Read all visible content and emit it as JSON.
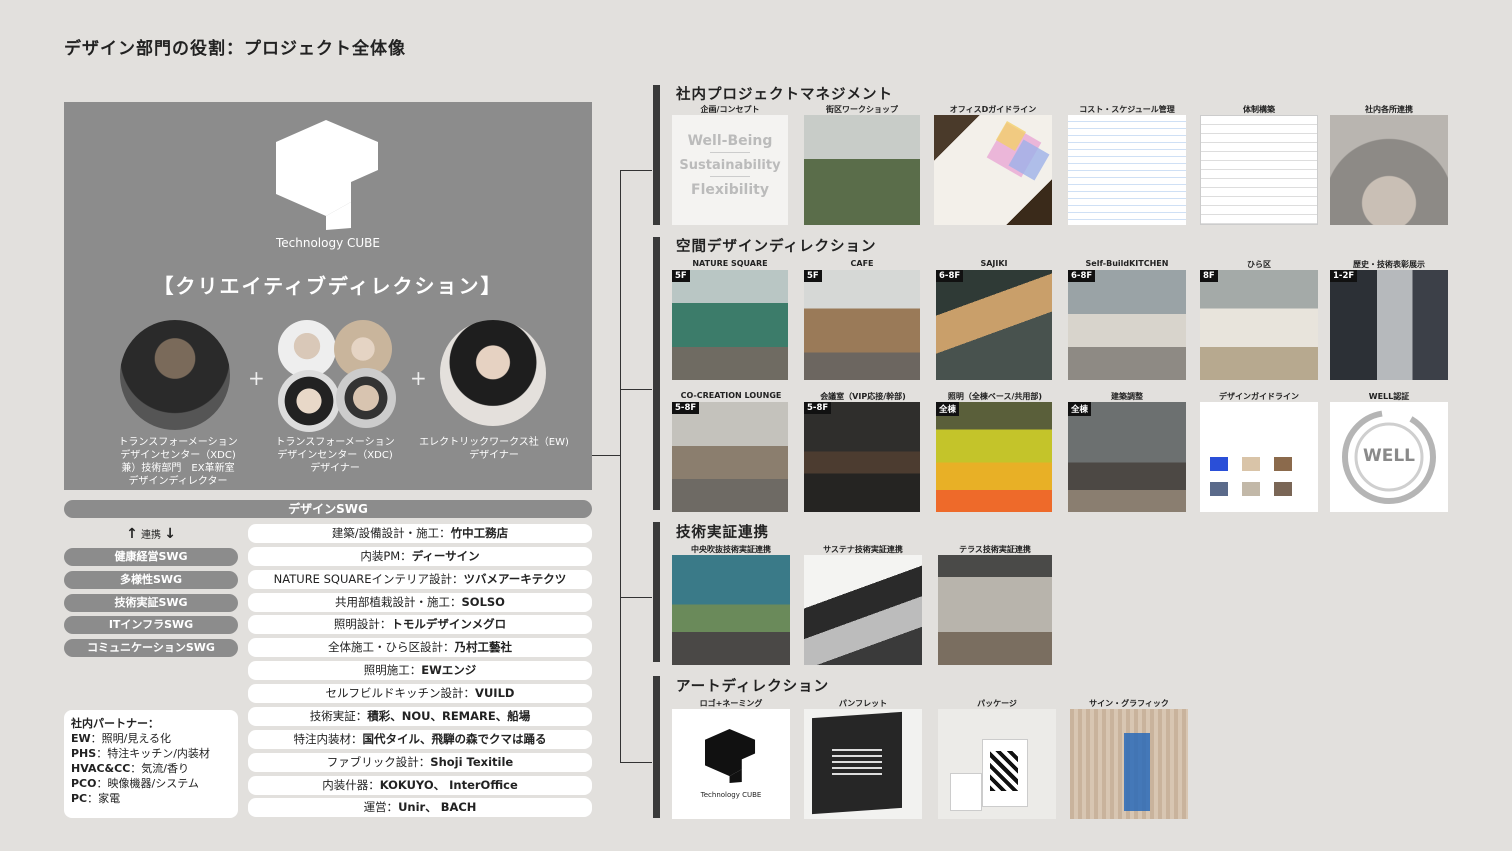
{
  "page_title": "デザイン部門の役割：プロジェクト全体像",
  "hero": {
    "logo_text": "Technology CUBE",
    "title": "【クリエイティブディレクション】",
    "plus": "+",
    "captions": [
      [
        "トランスフォーメーション",
        "デザインセンター（XDC)",
        "兼）技術部門　EX革新室",
        "デザインディレクター"
      ],
      [
        "トランスフォーメーション",
        "デザインセンター（XDC)",
        "デザイナー"
      ],
      [
        "エレクトリックワークス社（EW)",
        "デザイナー"
      ]
    ]
  },
  "swg": {
    "main": "デザインSWG",
    "renkei": "連携",
    "pills": [
      "健康経営SWG",
      "多様性SWG",
      "技術実証SWG",
      "ITインフラSWG",
      "コミュニケーションSWG"
    ]
  },
  "roles": [
    {
      "label": "建築/設備設計・施工：",
      "value": "竹中工務店"
    },
    {
      "label": "内装PM：",
      "value": "ディーサイン"
    },
    {
      "label": "NATURE SQUAREインテリア設計：",
      "value": "ツバメアーキテクツ"
    },
    {
      "label": "共用部植栽設計・施工：",
      "value": "SOLSO"
    },
    {
      "label": "照明設計：",
      "value": "トモルデザインメグロ"
    },
    {
      "label": "全体施工・ひら区設計：",
      "value": "乃村工藝社"
    },
    {
      "label": "照明施工：",
      "value": "EWエンジ"
    },
    {
      "label": "セルフビルドキッチン設計：",
      "value": "VUILD"
    },
    {
      "label": "技術実証：",
      "value": "積彩、NOU、REMARE、船場"
    },
    {
      "label": "特注内装材：",
      "value": "国代タイル、飛騨の森でクマは踊る"
    },
    {
      "label": "ファブリック設計：",
      "value": "Shoji Texitile"
    },
    {
      "label": "内装什器：",
      "value": "KOKUYO、 InterOffice"
    },
    {
      "label": "運営：",
      "value": "Unir、 BACH"
    }
  ],
  "partner": {
    "title": "社内パートナー：",
    "lines": [
      {
        "k": "EW",
        "v": "：照明/見える化"
      },
      {
        "k": "PHS",
        "v": "：特注キッチン/内装材"
      },
      {
        "k": "HVAC&CC",
        "v": "：気流/香り"
      },
      {
        "k": "PCO",
        "v": "：映像機器/システム"
      },
      {
        "k": "PC",
        "v": "：家電"
      }
    ]
  },
  "sections": {
    "pm": {
      "title": "社内プロジェクトマネジメント",
      "items": [
        "企画/コンセプト",
        "街区ワークショップ",
        "オフィスDガイドライン",
        "コスト・スケジュール管理",
        "体制構築",
        "社内各所連携"
      ],
      "concept_words": [
        "Well-Being",
        "Sustainability",
        "Flexibility"
      ]
    },
    "space": {
      "title": "空間デザインディレクション",
      "row1": [
        {
          "label": "NATURE SQUARE",
          "floor": "5F"
        },
        {
          "label": "CAFE",
          "floor": "5F"
        },
        {
          "label": "SAJIKI",
          "floor": "6-8F"
        },
        {
          "label": "Self-BuildKITCHEN",
          "floor": "6-8F"
        },
        {
          "label": "ひら区",
          "floor": "8F"
        },
        {
          "label": "歴史・技術表彰展示",
          "floor": "1-2F"
        }
      ],
      "row2": [
        {
          "label": "CO-CREATION LOUNGE",
          "floor": "5-8F"
        },
        {
          "label": "会議室（VIP応接/幹部)",
          "floor": "5-8F"
        },
        {
          "label": "照明（全棟ベース/共用部)",
          "floor": "全棟"
        },
        {
          "label": "建築調整",
          "floor": "全棟"
        },
        {
          "label": "デザインガイドライン",
          "floor": ""
        },
        {
          "label": "WELL認証",
          "floor": ""
        }
      ],
      "well_text": "WELL"
    },
    "tech": {
      "title": "技術実証連携",
      "items": [
        "中央吹抜技術実証連携",
        "サステナ技術実証連携",
        "テラス技術実証連携"
      ]
    },
    "art": {
      "title": "アートディレクション",
      "items": [
        "ロゴ+ネーミング",
        "パンフレット",
        "パッケージ",
        "サイン・グラフィック"
      ],
      "logo_caption": "Technology CUBE"
    }
  },
  "colors": {
    "background": "#e2e0dd",
    "panel_gray": "#8c8c8c",
    "section_bar": "#3a3a3a"
  }
}
